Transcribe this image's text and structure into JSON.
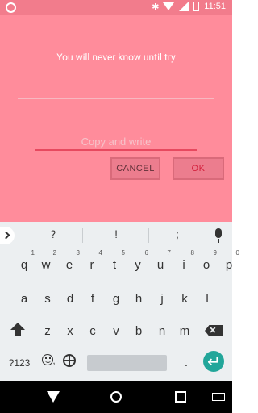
{
  "statusbar": {
    "time": "11:51"
  },
  "dialog": {
    "title": "You will never know until try",
    "input_placeholder": "Copy and write",
    "cancel_label": "CANCEL",
    "ok_label": "OK"
  },
  "keyboard": {
    "suggestions": [
      "?",
      "!",
      ";"
    ],
    "row1": [
      {
        "k": "q",
        "n": "1"
      },
      {
        "k": "w",
        "n": "2"
      },
      {
        "k": "e",
        "n": "3"
      },
      {
        "k": "r",
        "n": "4"
      },
      {
        "k": "t",
        "n": "5"
      },
      {
        "k": "y",
        "n": "6"
      },
      {
        "k": "u",
        "n": "7"
      },
      {
        "k": "i",
        "n": "8"
      },
      {
        "k": "o",
        "n": "9"
      },
      {
        "k": "p",
        "n": "0"
      }
    ],
    "row2": [
      "a",
      "s",
      "d",
      "f",
      "g",
      "h",
      "j",
      "k",
      "l"
    ],
    "row3": [
      "z",
      "x",
      "c",
      "v",
      "b",
      "n",
      "m"
    ],
    "sym_label": "?123",
    "comma_label": ",",
    "period_label": "."
  }
}
